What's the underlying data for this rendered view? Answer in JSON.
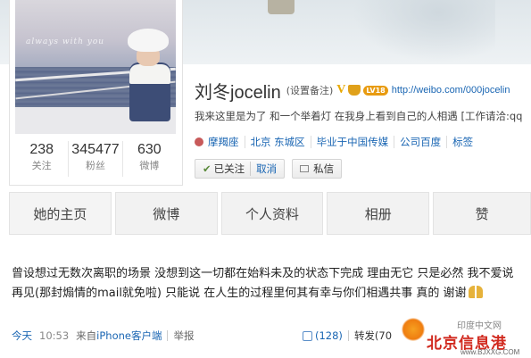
{
  "profile": {
    "avatar_caption": "always with you",
    "stats": [
      {
        "value": "238",
        "label": "关注"
      },
      {
        "value": "345477",
        "label": "粉丝"
      },
      {
        "value": "630",
        "label": "微博"
      }
    ],
    "name": "刘冬jocelin",
    "remark": "(设置备注)",
    "verified_badge": "V",
    "level_badge": "LV18",
    "url": "http://weibo.com/000jocelin",
    "bio": "我来这里是为了 和一个举着灯 在我身上看到自己的人相遇 [工作请洽:qq",
    "meta": {
      "zodiac": "摩羯座",
      "location": "北京 东城区",
      "school": "毕业于中国传媒",
      "company": "公司百度",
      "tags": "标签"
    },
    "followed_label": "已关注",
    "cancel_label": "取消",
    "message_label": "私信"
  },
  "tabs": [
    "她的主页",
    "微博",
    "个人资料",
    "相册",
    "赞"
  ],
  "post": {
    "text": "曾设想过无数次离职的场景 没想到这一切都在始料未及的状态下完成 理由无它 只是必然 我不爱说再见(那封煽情的mail就免啦) 只能说 在人生的过程里何其有幸与你们相遇共事 真的 谢谢",
    "time": "今天",
    "clock": "10:53",
    "from_prefix": "来自",
    "client": "iPhone客户端",
    "report": "举报",
    "likes": "(128)",
    "repost": "转发(70"
  },
  "watermark": {
    "small": "印度中文网",
    "big": "北京信息港",
    "domain": "www.BJXXG.COM"
  },
  "colors": {
    "link": "#1a66b3",
    "badge": "#e89b10"
  }
}
